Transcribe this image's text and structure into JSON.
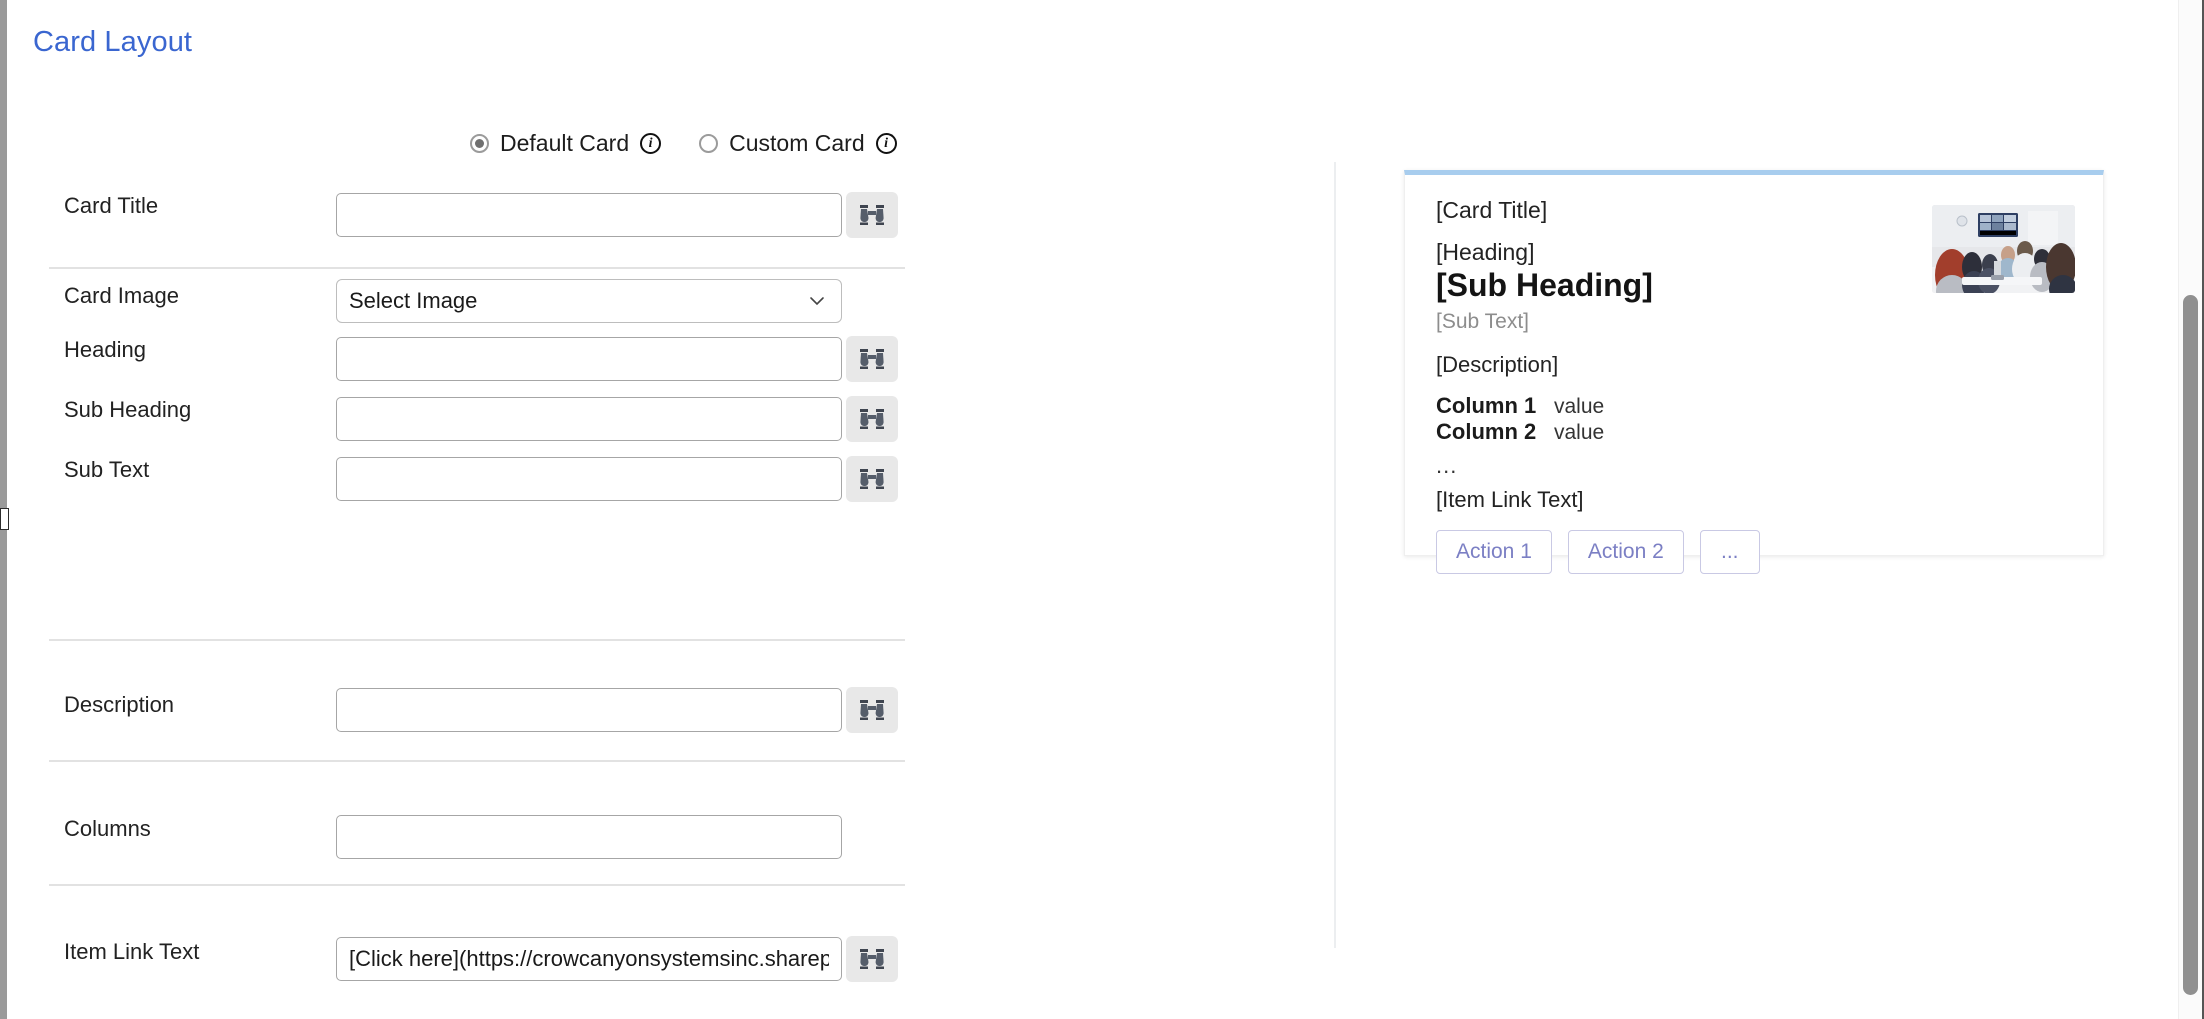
{
  "page": {
    "title": "Card Layout"
  },
  "card_type": {
    "options": [
      {
        "label": "Default Card",
        "selected": true,
        "info_icon": "info-icon"
      },
      {
        "label": "Custom Card",
        "selected": false,
        "info_icon": "info-icon"
      }
    ]
  },
  "fields": {
    "card_title": {
      "label": "Card Title",
      "value": "",
      "placeholder": ""
    },
    "card_image": {
      "label": "Card Image",
      "value": "Select Image",
      "caret_icon": "chevron-down-icon"
    },
    "heading": {
      "label": "Heading",
      "value": "",
      "placeholder": ""
    },
    "sub_heading": {
      "label": "Sub Heading",
      "value": "",
      "placeholder": ""
    },
    "sub_text": {
      "label": "Sub Text",
      "value": "",
      "placeholder": ""
    },
    "description": {
      "label": "Description",
      "value": "",
      "placeholder": ""
    },
    "columns": {
      "label": "Columns",
      "value": "",
      "placeholder": ""
    },
    "item_link_text": {
      "label": "Item Link Text",
      "value": "[Click here](https://crowcanyonsystemsinc.sharepoint.co",
      "placeholder": ""
    }
  },
  "lookup_button": {
    "icon": "binoculars-icon",
    "label": ""
  },
  "preview": {
    "card_title": "[Card Title]",
    "heading": "[Heading]",
    "sub_heading": "[Sub Heading]",
    "sub_text": "[Sub Text]",
    "description": "[Description]",
    "columns": [
      {
        "name": "Column 1",
        "value": "value"
      },
      {
        "name": "Column 2",
        "value": "value"
      }
    ],
    "more_indicator": "...",
    "item_link_text": "[Item Link Text]",
    "actions": [
      {
        "label": "Action 1"
      },
      {
        "label": "Action 2"
      },
      {
        "label": "..."
      }
    ],
    "image_alt": "meeting-room-photo"
  },
  "colors": {
    "heading_blue": "#3a66d0",
    "card_accent": "#a8cdee",
    "action_text": "#7b7fc4",
    "action_border": "#c9c9e4",
    "separator": "#e2e2e2",
    "input_border": "#a6a6a6",
    "lookup_button_bg": "#e8e8e8"
  }
}
